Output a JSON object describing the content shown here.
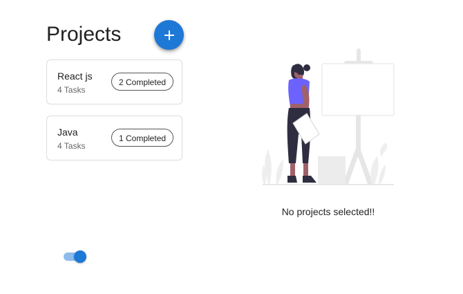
{
  "header": {
    "title": "Projects",
    "add_icon": "plus-icon"
  },
  "projects": [
    {
      "name": "React js",
      "tasks": "4 Tasks",
      "completed": "2 Completed"
    },
    {
      "name": "Java",
      "tasks": "4 Tasks",
      "completed": "1 Completed"
    }
  ],
  "empty_state": {
    "message": "No projects selected!!",
    "illustration": "person-with-easel-illustration"
  },
  "theme_toggle": {
    "state": "on",
    "icon": "toggle-switch"
  },
  "colors": {
    "accent": "#1e78d6",
    "illustration_figure": "#6c63ff",
    "illustration_neutral": "#e6e6e6"
  }
}
